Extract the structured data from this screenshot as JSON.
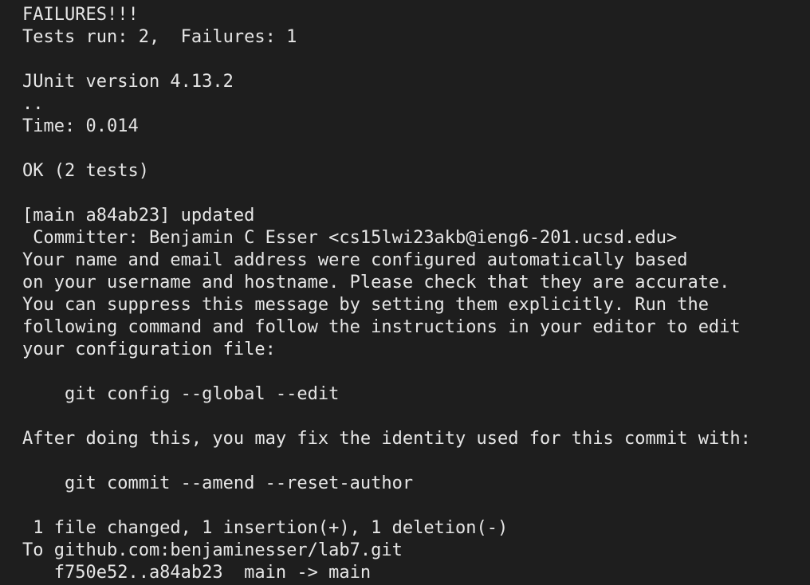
{
  "terminal": {
    "background": "#1e1e1e",
    "foreground": "#e6e6e6",
    "lines": [
      "FAILURES!!!",
      "Tests run: 2,  Failures: 1",
      "",
      "JUnit version 4.13.2",
      "..",
      "Time: 0.014",
      "",
      "OK (2 tests)",
      "",
      "[main a84ab23] updated",
      " Committer: Benjamin C Esser <cs15lwi23akb@ieng6-201.ucsd.edu>",
      "Your name and email address were configured automatically based",
      "on your username and hostname. Please check that they are accurate.",
      "You can suppress this message by setting them explicitly. Run the",
      "following command and follow the instructions in your editor to edit",
      "your configuration file:",
      "",
      "    git config --global --edit",
      "",
      "After doing this, you may fix the identity used for this commit with:",
      "",
      "    git commit --amend --reset-author",
      "",
      " 1 file changed, 1 insertion(+), 1 deletion(-)",
      "To github.com:benjaminesser/lab7.git",
      "   f750e52..a84ab23  main -> main"
    ]
  }
}
